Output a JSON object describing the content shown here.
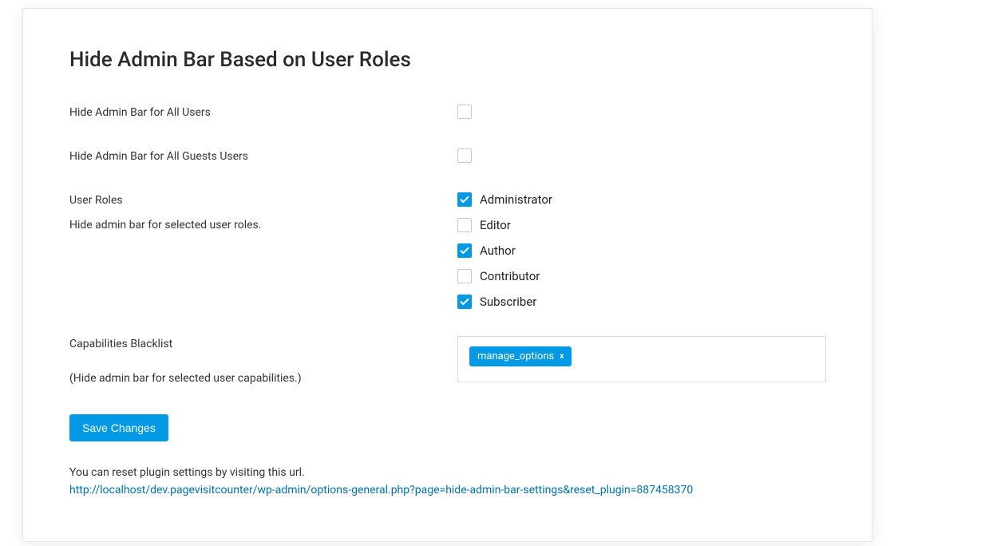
{
  "title": "Hide Admin Bar Based on User Roles",
  "fields": {
    "hide_all_users": {
      "label": "Hide Admin Bar for All Users",
      "checked": false
    },
    "hide_all_guests": {
      "label": "Hide Admin Bar for All Guests Users",
      "checked": false
    },
    "user_roles": {
      "label": "User Roles",
      "help": "Hide admin bar for selected user roles.",
      "options": [
        {
          "label": "Administrator",
          "checked": true
        },
        {
          "label": "Editor",
          "checked": false
        },
        {
          "label": "Author",
          "checked": true
        },
        {
          "label": "Contributor",
          "checked": false
        },
        {
          "label": "Subscriber",
          "checked": true
        }
      ]
    },
    "capabilities_blacklist": {
      "label": "Capabilities Blacklist",
      "help": "(Hide admin bar for selected user capabilities.)",
      "tags": [
        {
          "label": "manage_options"
        }
      ]
    }
  },
  "save_button": "Save Changes",
  "reset": {
    "note": "You can reset plugin settings by visiting this url.",
    "url": "http://localhost/dev.pagevisitcounter/wp-admin/options-general.php?page=hide-admin-bar-settings&reset_plugin=887458370"
  }
}
